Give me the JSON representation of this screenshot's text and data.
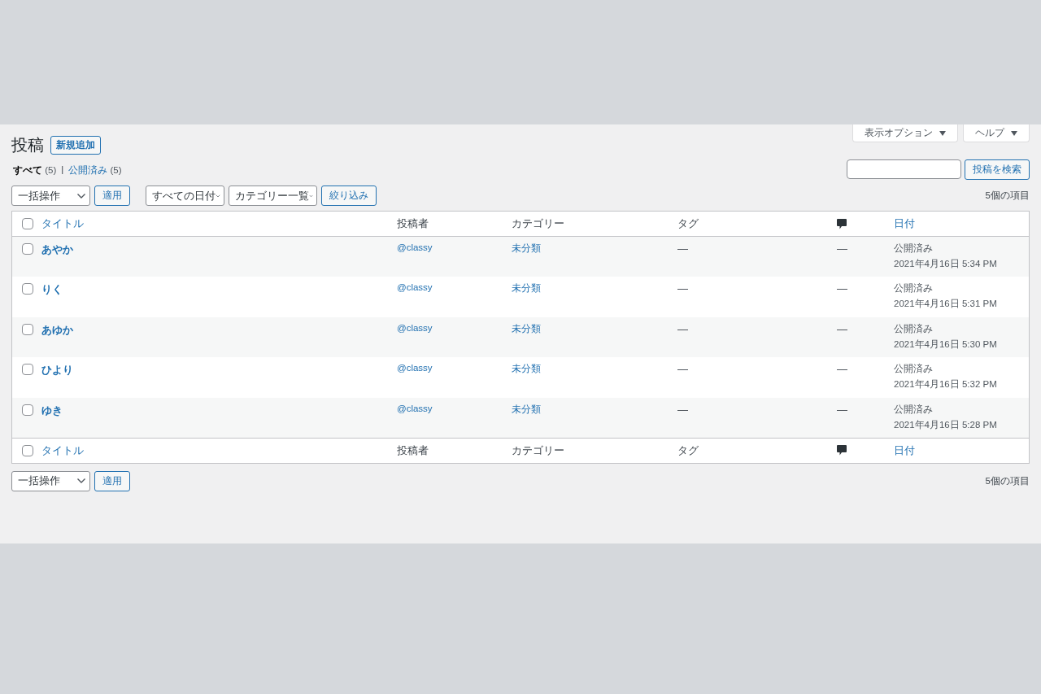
{
  "screen_options": "表示オプション",
  "help": "ヘルプ",
  "page_title": "投稿",
  "add_new": "新規追加",
  "views": [
    {
      "label": "すべて",
      "count": "(5)",
      "selected": true
    },
    {
      "label": "公開済み",
      "count": "(5)",
      "selected": false
    }
  ],
  "views_separator": "|",
  "search_button": "投稿を検索",
  "top_nav": {
    "bulk_action": "一括操作",
    "apply": "適用",
    "filters": [
      "すべての日付",
      "カテゴリー一覧"
    ],
    "filter_button": "絞り込み",
    "items_count": "5個の項目"
  },
  "table": {
    "columns": [
      {
        "kind": "link",
        "label": "タイトル"
      },
      {
        "kind": "text",
        "label": "投稿者"
      },
      {
        "kind": "text",
        "label": "カテゴリー"
      },
      {
        "kind": "text",
        "label": "タグ"
      },
      {
        "kind": "comment-icon"
      },
      {
        "kind": "link",
        "label": "日付"
      }
    ],
    "header_checked": false,
    "rows": [
      {
        "checked": false,
        "title": "あやか",
        "author": "@classy",
        "category": "未分類",
        "tags": "—",
        "comments": "—",
        "status": "公開済み",
        "date": "2021年4月16日 5:34 PM"
      },
      {
        "checked": false,
        "title": "りく",
        "author": "@classy",
        "category": "未分類",
        "tags": "—",
        "comments": "—",
        "status": "公開済み",
        "date": "2021年4月16日 5:31 PM"
      },
      {
        "checked": false,
        "title": "あゆか",
        "author": "@classy",
        "category": "未分類",
        "tags": "—",
        "comments": "—",
        "status": "公開済み",
        "date": "2021年4月16日 5:30 PM"
      },
      {
        "checked": false,
        "title": "ひより",
        "author": "@classy",
        "category": "未分類",
        "tags": "—",
        "comments": "—",
        "status": "公開済み",
        "date": "2021年4月16日 5:32 PM"
      },
      {
        "checked": false,
        "title": "ゆき",
        "author": "@classy",
        "category": "未分類",
        "tags": "—",
        "comments": "—",
        "status": "公開済み",
        "date": "2021年4月16日 5:28 PM"
      }
    ],
    "footer_columns": [
      {
        "kind": "link",
        "label": "タイトル"
      },
      {
        "kind": "text",
        "label": "投稿者"
      },
      {
        "kind": "text",
        "label": "カテゴリー"
      },
      {
        "kind": "text",
        "label": "タグ"
      },
      {
        "kind": "comment-icon"
      },
      {
        "kind": "link",
        "label": "日付"
      }
    ],
    "footer_checked": false
  },
  "bottom_nav": {
    "bulk_action": "一括操作",
    "apply": "適用",
    "items_count": "5個の項目"
  }
}
